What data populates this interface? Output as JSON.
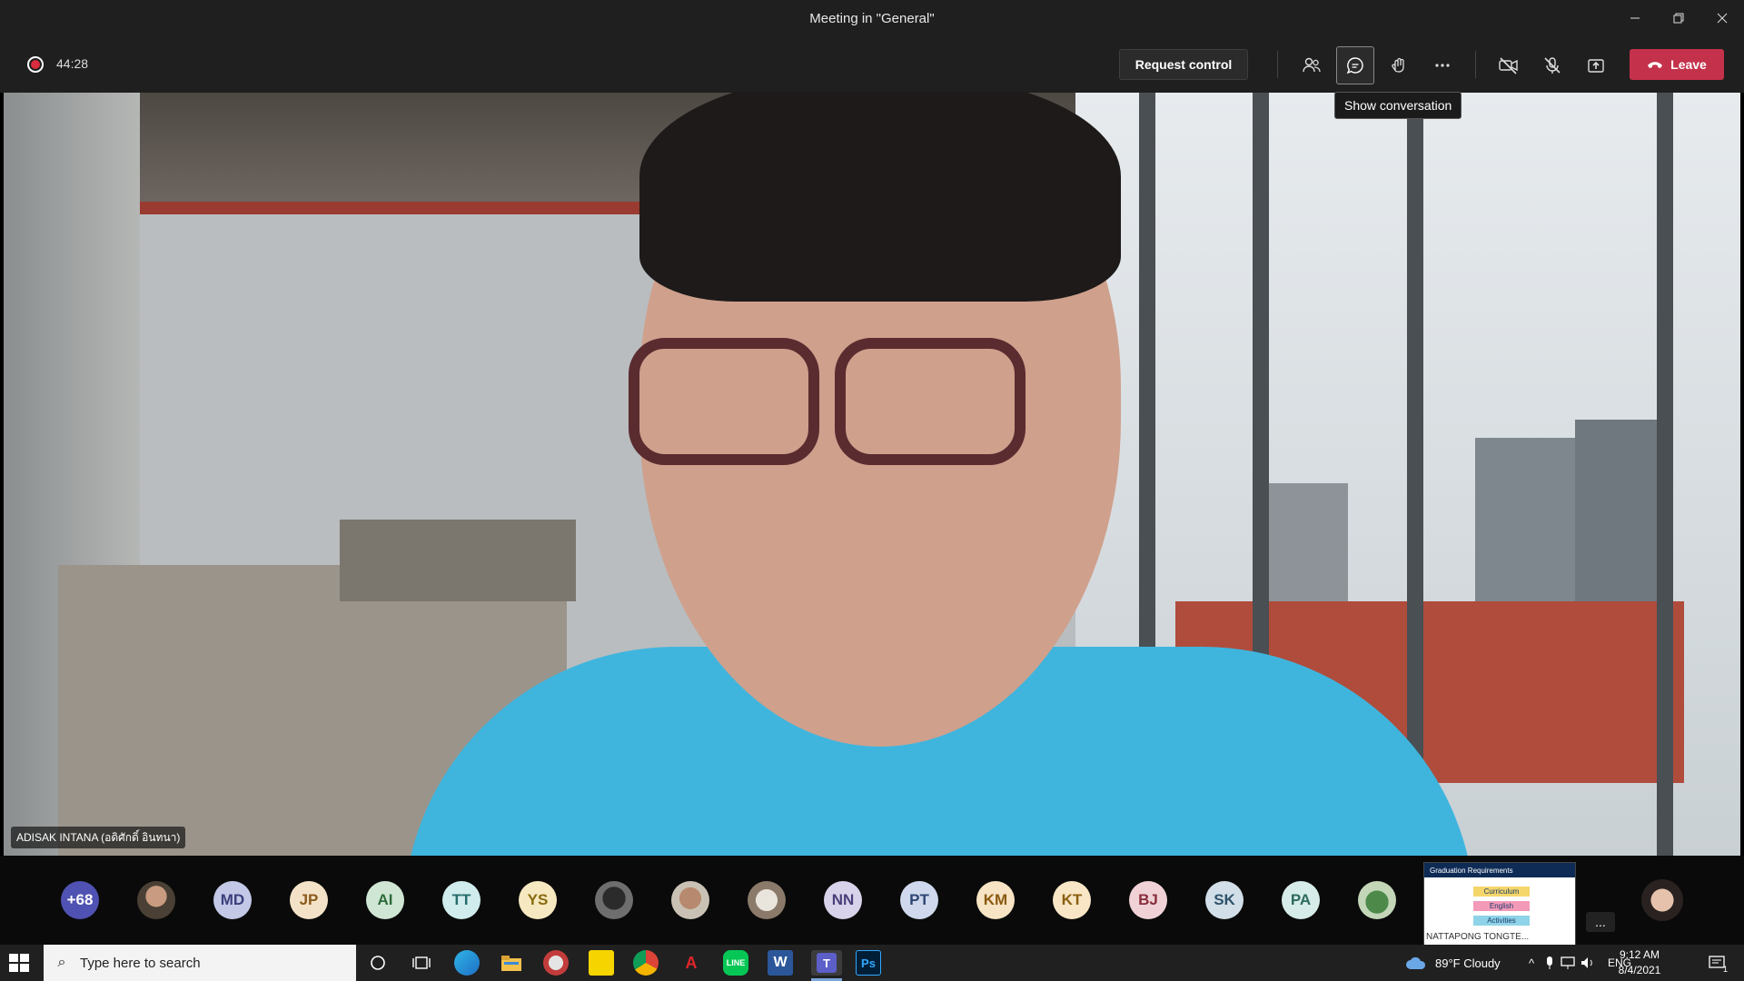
{
  "window": {
    "title": "Meeting in \"General\""
  },
  "toolbar": {
    "timer": "44:28",
    "request_control_label": "Request control",
    "leave_label": "Leave",
    "tooltip": "Show conversation"
  },
  "video": {
    "speaker_name": "ADISAK INTANA (อดิศักดิ์ อินทนา)"
  },
  "participants": {
    "overflow_count": "+68",
    "initials": [
      "MD",
      "JP",
      "AI",
      "TT",
      "YS",
      "NN",
      "PT",
      "KM",
      "KT",
      "BJ",
      "SK",
      "PA"
    ],
    "slide": {
      "title": "Graduation Requirements",
      "items": [
        "Curriculum",
        "English",
        "Activities"
      ],
      "presenter": "NATTAPONG TONGTE..."
    },
    "more": "..."
  },
  "colors": {
    "leave": "#c4314b",
    "accent": "#6264a7",
    "toolbar_bg": "#1f1f1f"
  },
  "taskbar": {
    "search_placeholder": "Type here to search",
    "weather": "89°F  Cloudy",
    "language": "ENG",
    "time": "9:12 AM",
    "date": "8/4/2021",
    "notification_count": "1"
  }
}
